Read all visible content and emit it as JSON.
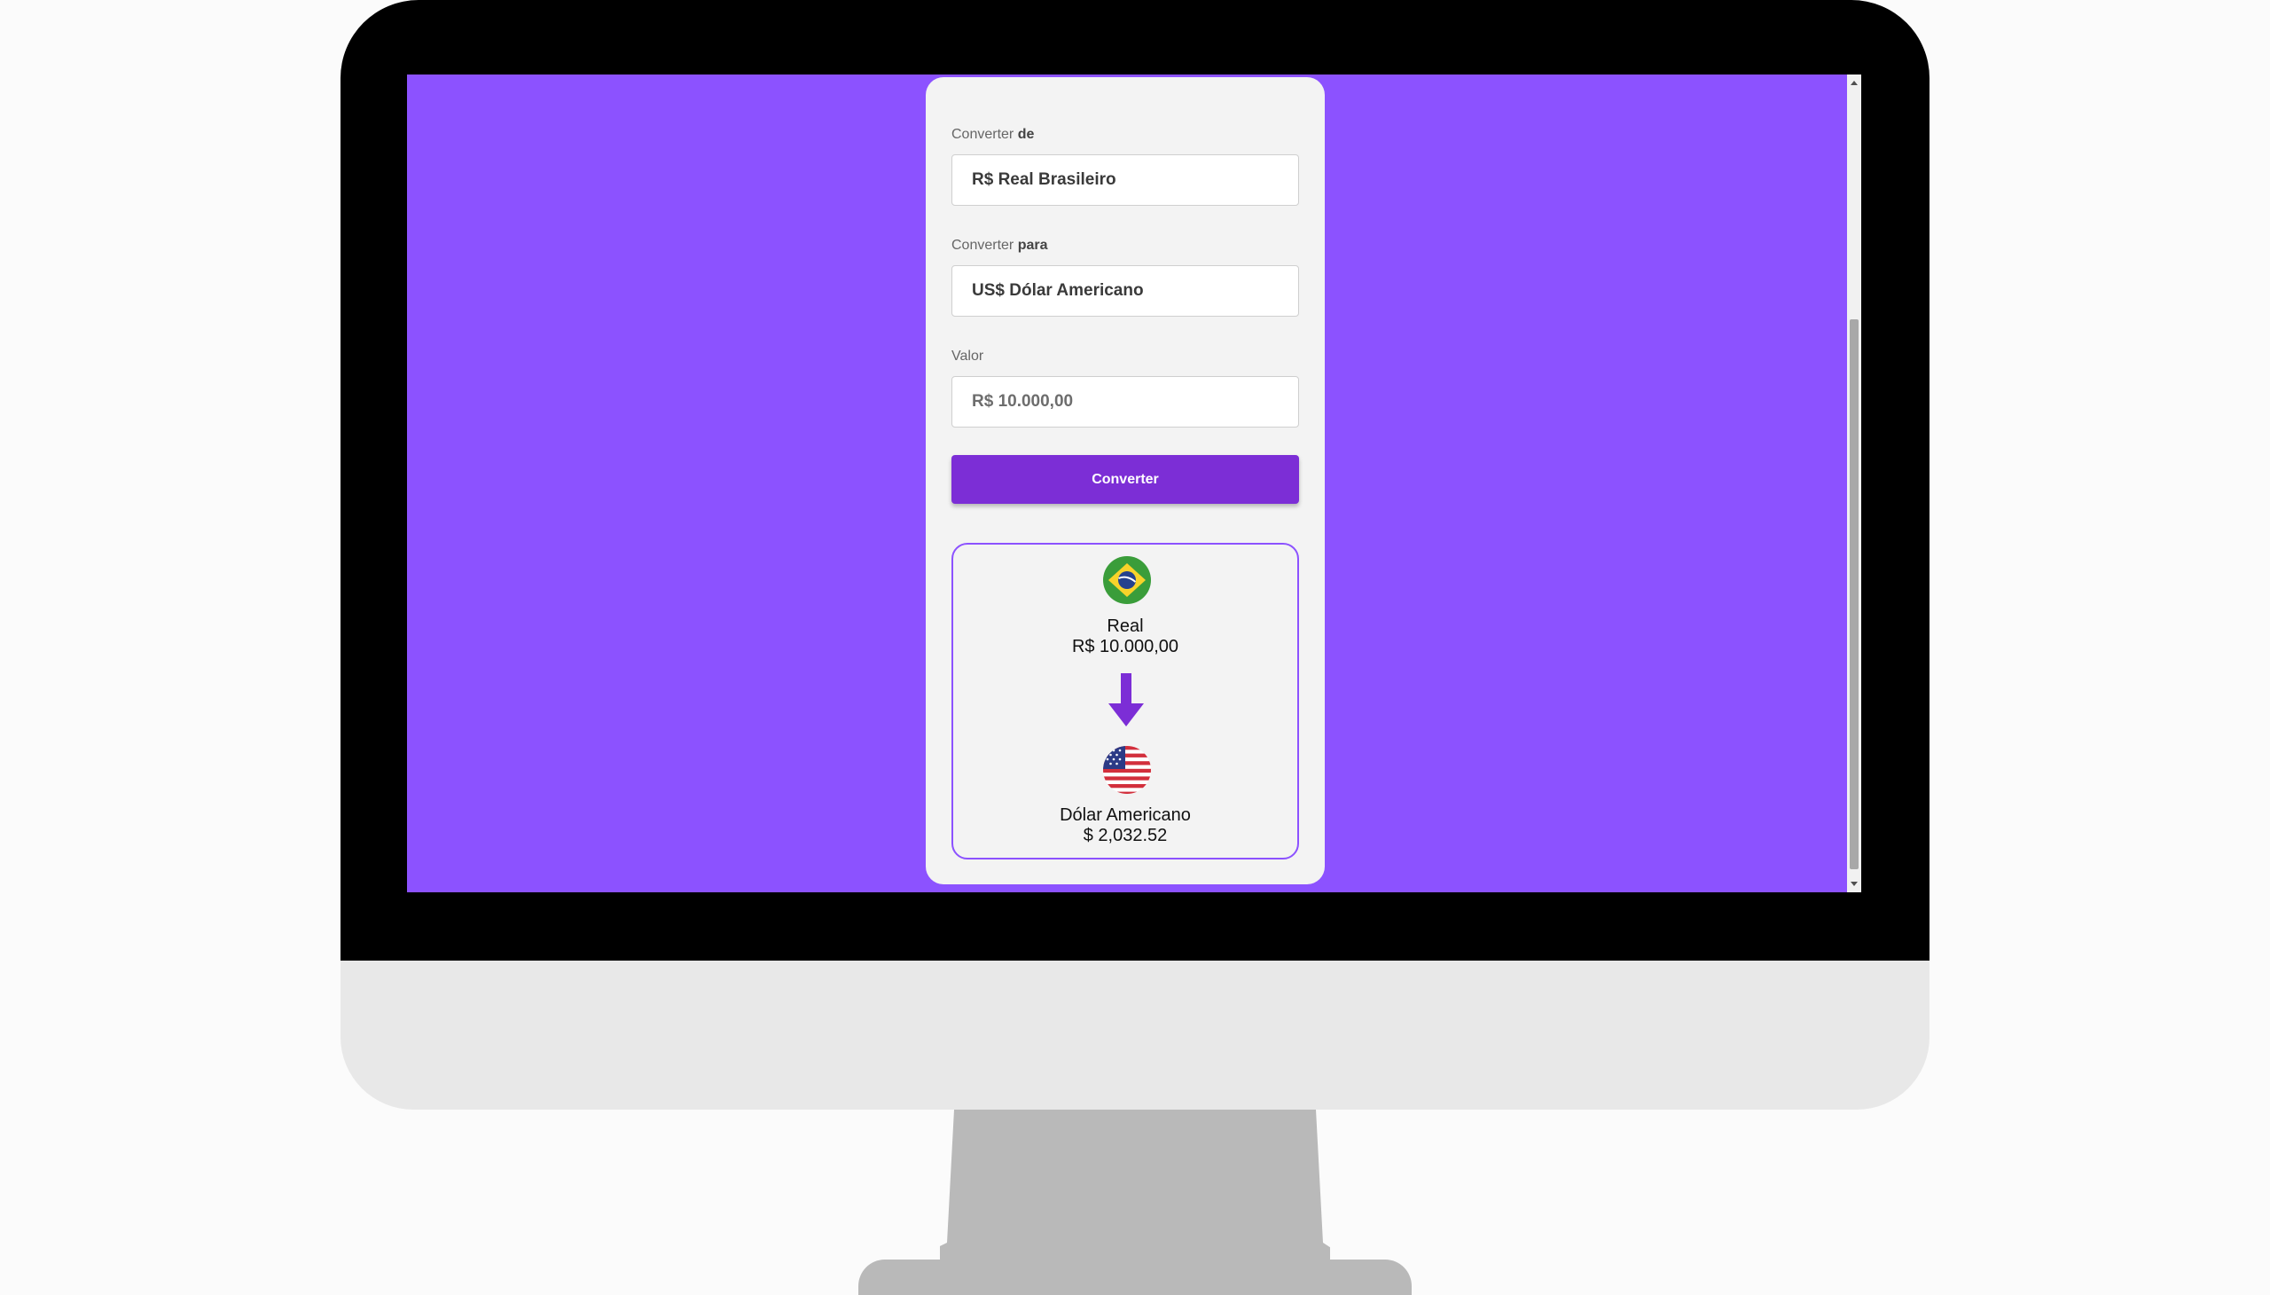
{
  "converter": {
    "from_label_prefix": "Converter",
    "from_label_bold": "de",
    "from_value": "R$ Real Brasileiro",
    "to_label_prefix": "Converter",
    "to_label_bold": "para",
    "to_value": "US$ Dólar Americano",
    "amount_label": "Valor",
    "amount_placeholder": "R$ 10.000,00",
    "button_label": "Converter"
  },
  "result": {
    "from_currency_name": "Real",
    "from_amount": "R$ 10.000,00",
    "from_flag": "brazil-flag-icon",
    "to_currency_name": "Dólar Americano",
    "to_amount": "$ 2,032.52",
    "to_flag": "usa-flag-icon"
  },
  "colors": {
    "background": "#8c52ff",
    "button": "#7c2ed6",
    "card": "#f3f3f3"
  }
}
